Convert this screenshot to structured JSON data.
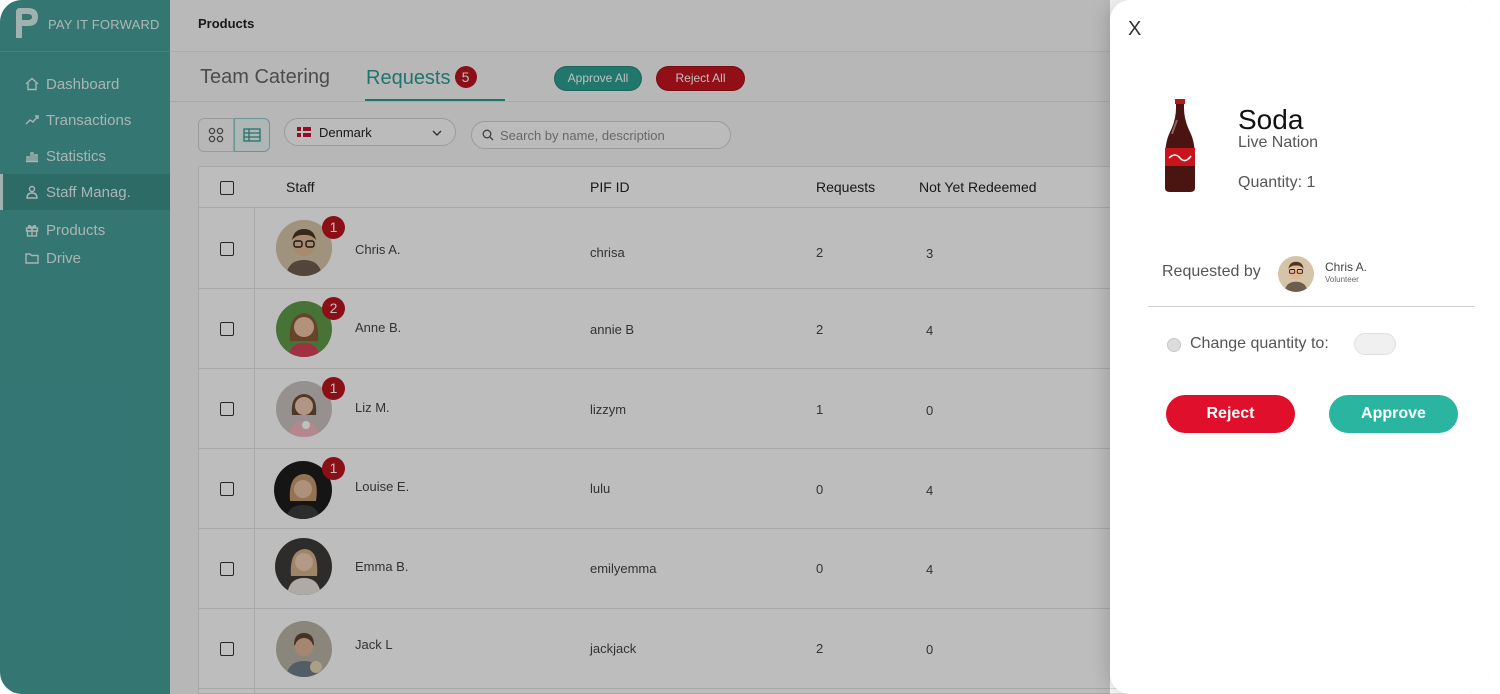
{
  "app": {
    "brand": "PAY IT FORWARD"
  },
  "sidebar": {
    "items": [
      {
        "label": "Dashboard",
        "icon": "home-icon"
      },
      {
        "label": "Transactions",
        "icon": "trend-icon"
      },
      {
        "label": "Statistics",
        "icon": "bar-chart-icon"
      },
      {
        "label": "Staff Manag.",
        "icon": "staff-icon",
        "active": true
      },
      {
        "label": "Products",
        "icon": "gift-icon"
      },
      {
        "label": "Drive",
        "icon": "folder-icon"
      }
    ]
  },
  "header": {
    "breadcrumb": "Products"
  },
  "tabs": {
    "team_catering": "Team Catering",
    "requests": "Requests",
    "requests_count": "5"
  },
  "actions": {
    "approve_all": "Approve All",
    "reject_all": "Reject All"
  },
  "filters": {
    "country": "Denmark",
    "search_placeholder": "Search by name, description"
  },
  "table": {
    "columns": {
      "staff": "Staff",
      "pif_id": "PIF ID",
      "requests": "Requests",
      "not_yet_redeemed": "Not Yet Redeemed"
    },
    "rows": [
      {
        "name": "Chris A.",
        "pif_id": "chrisa",
        "requests": "2",
        "not_redeemed": "3",
        "badge": "1"
      },
      {
        "name": "Anne B.",
        "pif_id": "annie B",
        "requests": "2",
        "not_redeemed": "4",
        "badge": "2"
      },
      {
        "name": "Liz M.",
        "pif_id": "lizzym",
        "requests": "1",
        "not_redeemed": "0",
        "badge": "1"
      },
      {
        "name": "Louise E.",
        "pif_id": "lulu",
        "requests": "0",
        "not_redeemed": "4",
        "badge": "1"
      },
      {
        "name": "Emma B.",
        "pif_id": "emilyemma",
        "requests": "0",
        "not_redeemed": "4",
        "badge": ""
      },
      {
        "name": "Jack L",
        "pif_id": "jackjack",
        "requests": "2",
        "not_redeemed": "0",
        "badge": ""
      }
    ]
  },
  "panel": {
    "close": "X",
    "product_name": "Soda",
    "venue": "Live Nation",
    "quantity": "Quantity: 1",
    "requested_by_label": "Requested by",
    "requester_name": "Chris A.",
    "requester_role": "Volunteer",
    "change_quantity_label": "Change quantity to:",
    "reject": "Reject",
    "approve": "Approve"
  },
  "colors": {
    "sidebar": "#469e99",
    "accent": "#2c9b8f",
    "danger": "#e00f2b",
    "badge": "#b8141e"
  }
}
